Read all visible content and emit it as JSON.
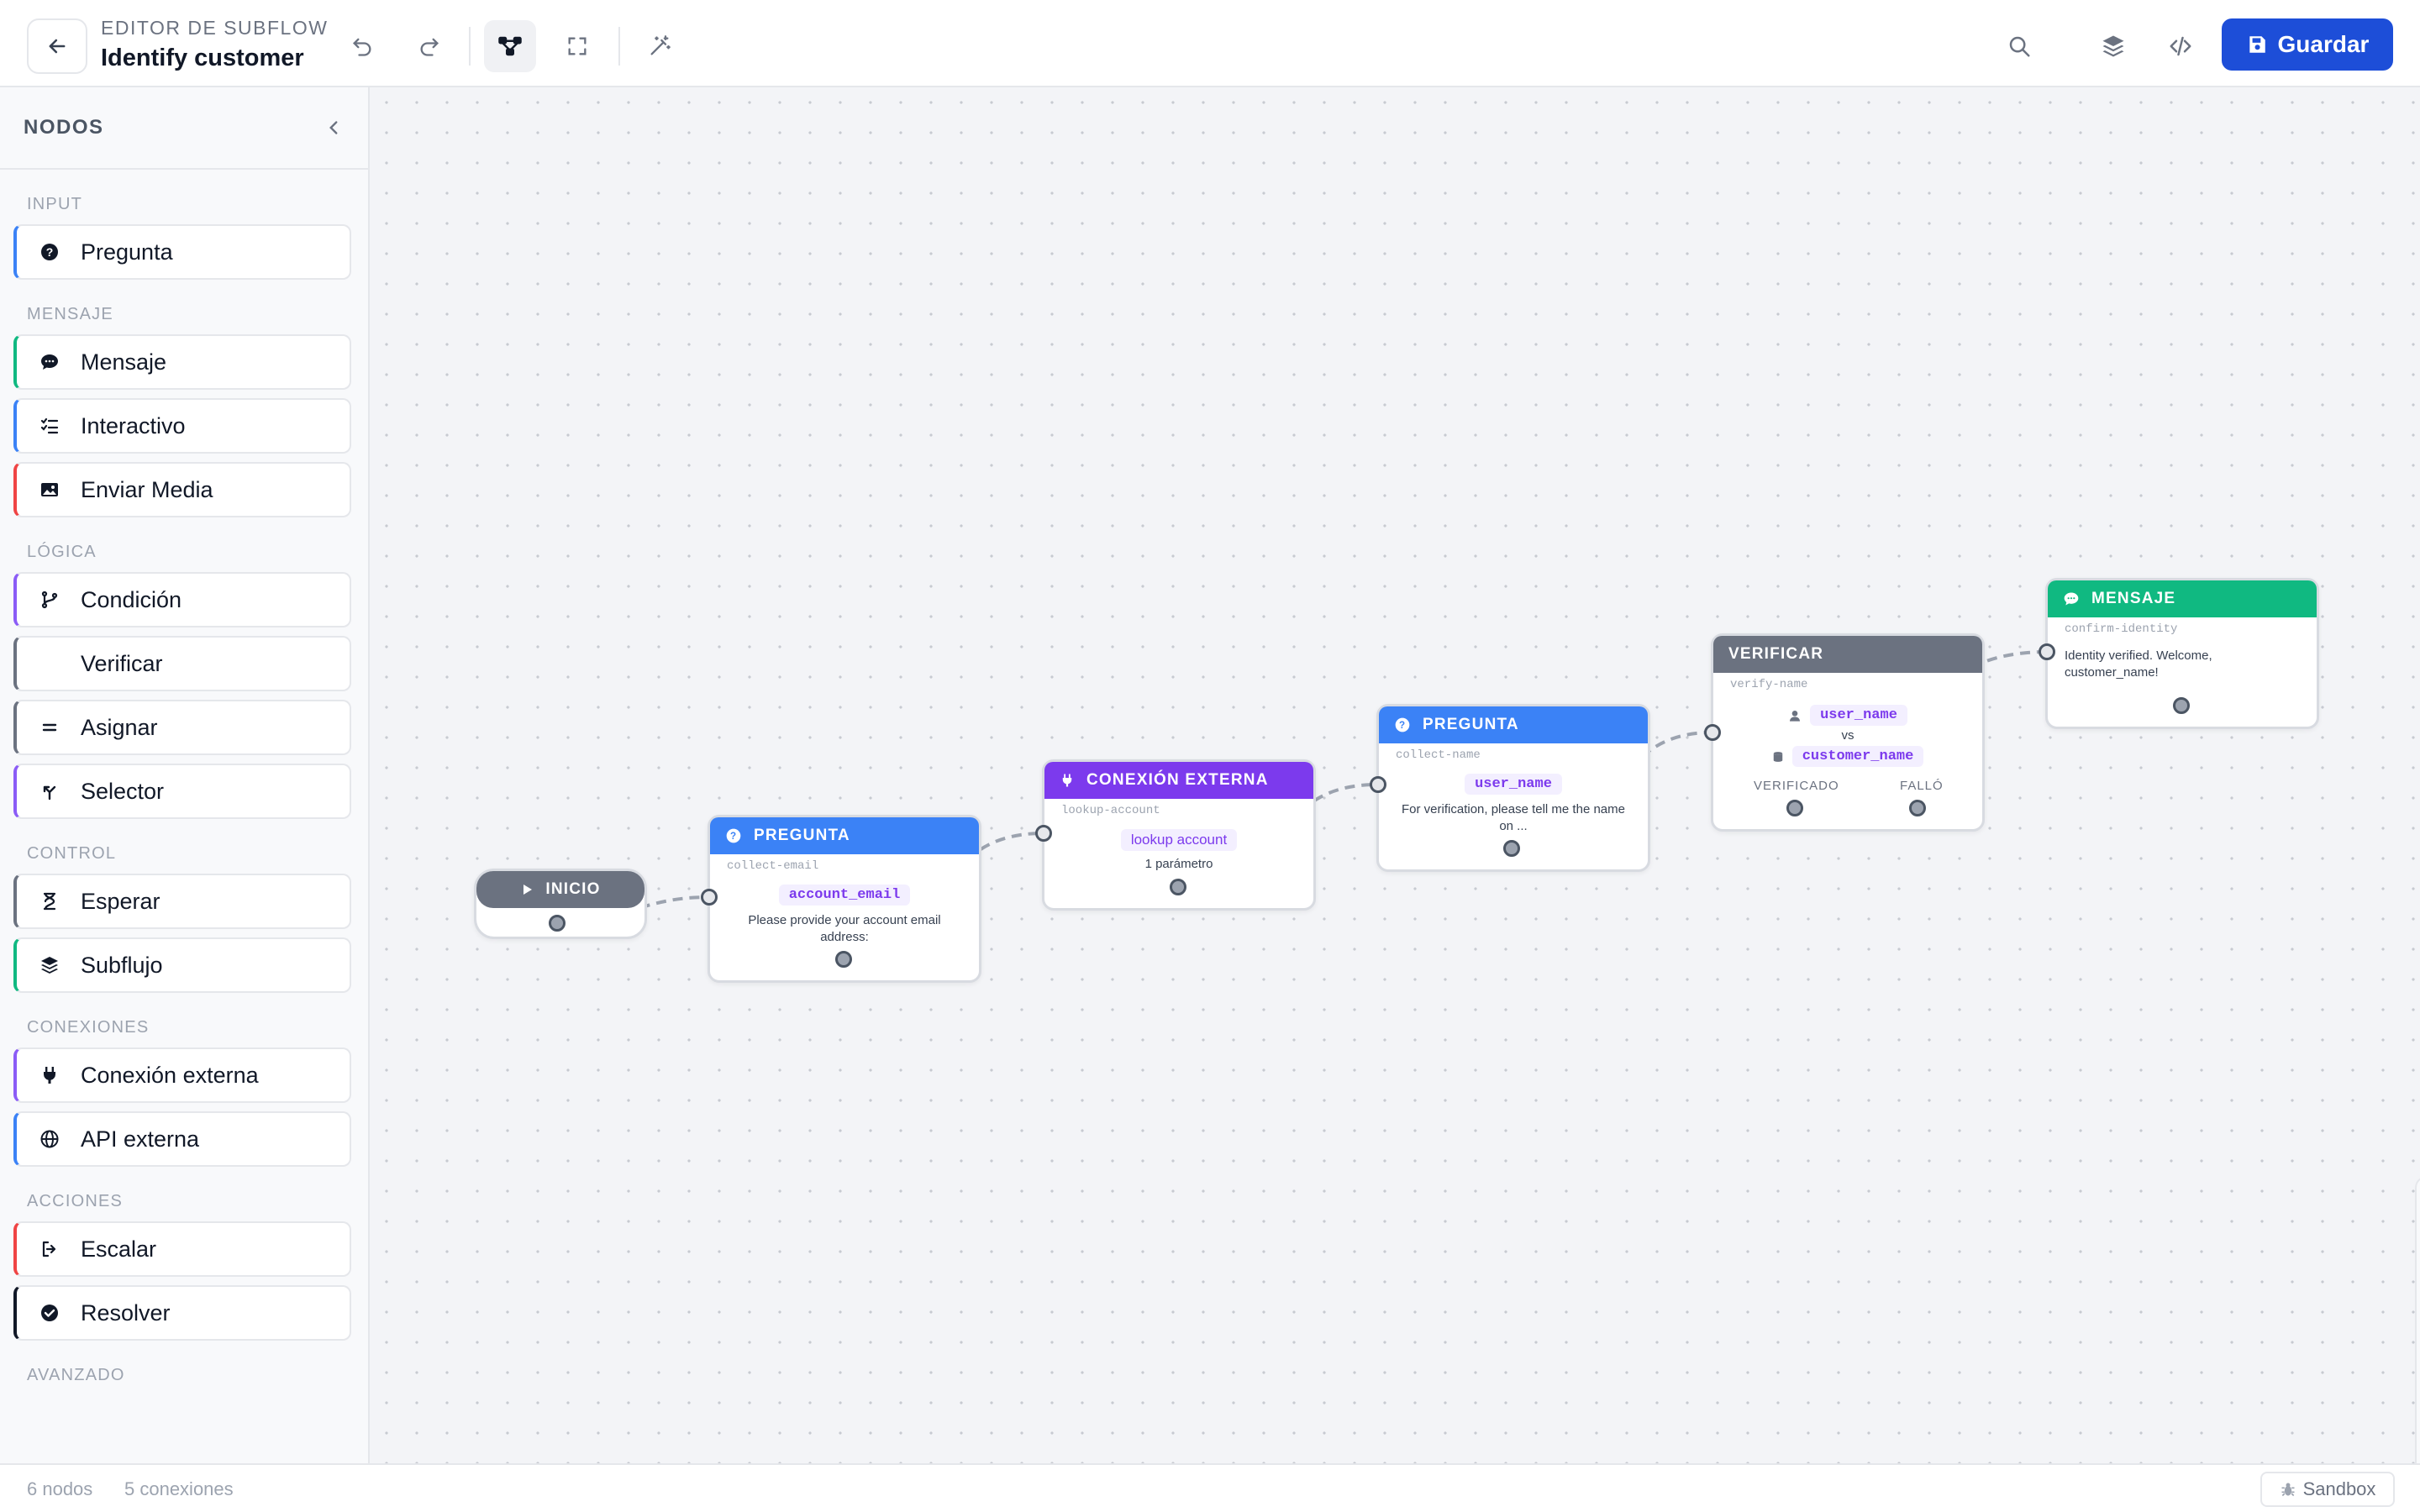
{
  "header": {
    "subtitle": "EDITOR DE SUBFLOW",
    "title": "Identify customer",
    "save_label": "Guardar"
  },
  "sidebar": {
    "title": "NODOS",
    "groups": [
      {
        "label": "INPUT",
        "items": [
          {
            "label": "Pregunta",
            "icon": "question-circle-icon",
            "color": "#3b82f6"
          }
        ]
      },
      {
        "label": "MENSAJE",
        "items": [
          {
            "label": "Mensaje",
            "icon": "chat-bubble-icon",
            "color": "#10b981"
          },
          {
            "label": "Interactivo",
            "icon": "checklist-icon",
            "color": "#3b82f6"
          },
          {
            "label": "Enviar Media",
            "icon": "image-icon",
            "color": "#ef4444"
          }
        ]
      },
      {
        "label": "LÓGICA",
        "items": [
          {
            "label": "Condición",
            "icon": "branch-icon",
            "color": "#8b5cf6"
          },
          {
            "label": "Verificar",
            "icon": "",
            "color": "#6b7280"
          },
          {
            "label": "Asignar",
            "icon": "equals-icon",
            "color": "#6b7280"
          },
          {
            "label": "Selector",
            "icon": "split-arrow-icon",
            "color": "#8b5cf6"
          }
        ]
      },
      {
        "label": "CONTROL",
        "items": [
          {
            "label": "Esperar",
            "icon": "hourglass-icon",
            "color": "#6b7280"
          },
          {
            "label": "Subflujo",
            "icon": "layers-icon",
            "color": "#10b981"
          }
        ]
      },
      {
        "label": "CONEXIONES",
        "items": [
          {
            "label": "Conexión externa",
            "icon": "plug-icon",
            "color": "#8b5cf6"
          },
          {
            "label": "API externa",
            "icon": "globe-icon",
            "color": "#3b82f6"
          }
        ]
      },
      {
        "label": "ACCIONES",
        "items": [
          {
            "label": "Escalar",
            "icon": "exit-icon",
            "color": "#ef4444"
          },
          {
            "label": "Resolver",
            "icon": "check-circle-icon",
            "color": "#111827"
          }
        ]
      },
      {
        "label": "AVANZADO",
        "items": []
      }
    ]
  },
  "nodes": {
    "start": {
      "label": "INICIO",
      "color": "#6b7280"
    },
    "q1": {
      "type": "PREGUNTA",
      "id": "collect-email",
      "variable": "account_email",
      "text": "Please provide your account email address:",
      "color": "#3b82f6"
    },
    "ext": {
      "type": "CONEXIÓN EXTERNA",
      "id": "lookup-account",
      "pill": "lookup account",
      "sub": "1 parámetro",
      "color": "#7c3aed"
    },
    "q2": {
      "type": "PREGUNTA",
      "id": "collect-name",
      "variable": "user_name",
      "text": "For verification, please tell me the name on ...",
      "color": "#3b82f6"
    },
    "verify": {
      "type": "VERIFICAR",
      "id": "verify-name",
      "left": "user_name",
      "vs": "vs",
      "right": "customer_name",
      "ok": "VERIFICADO",
      "fail": "FALLÓ",
      "color": "#6b7280"
    },
    "msg": {
      "type": "MENSAJE",
      "id": "confirm-identity",
      "text": "Identity verified. Welcome, customer_name!",
      "color": "#10b981"
    }
  },
  "status": {
    "nodes": "6 nodos",
    "connections": "5 conexiones",
    "sandbox": "Sandbox"
  }
}
